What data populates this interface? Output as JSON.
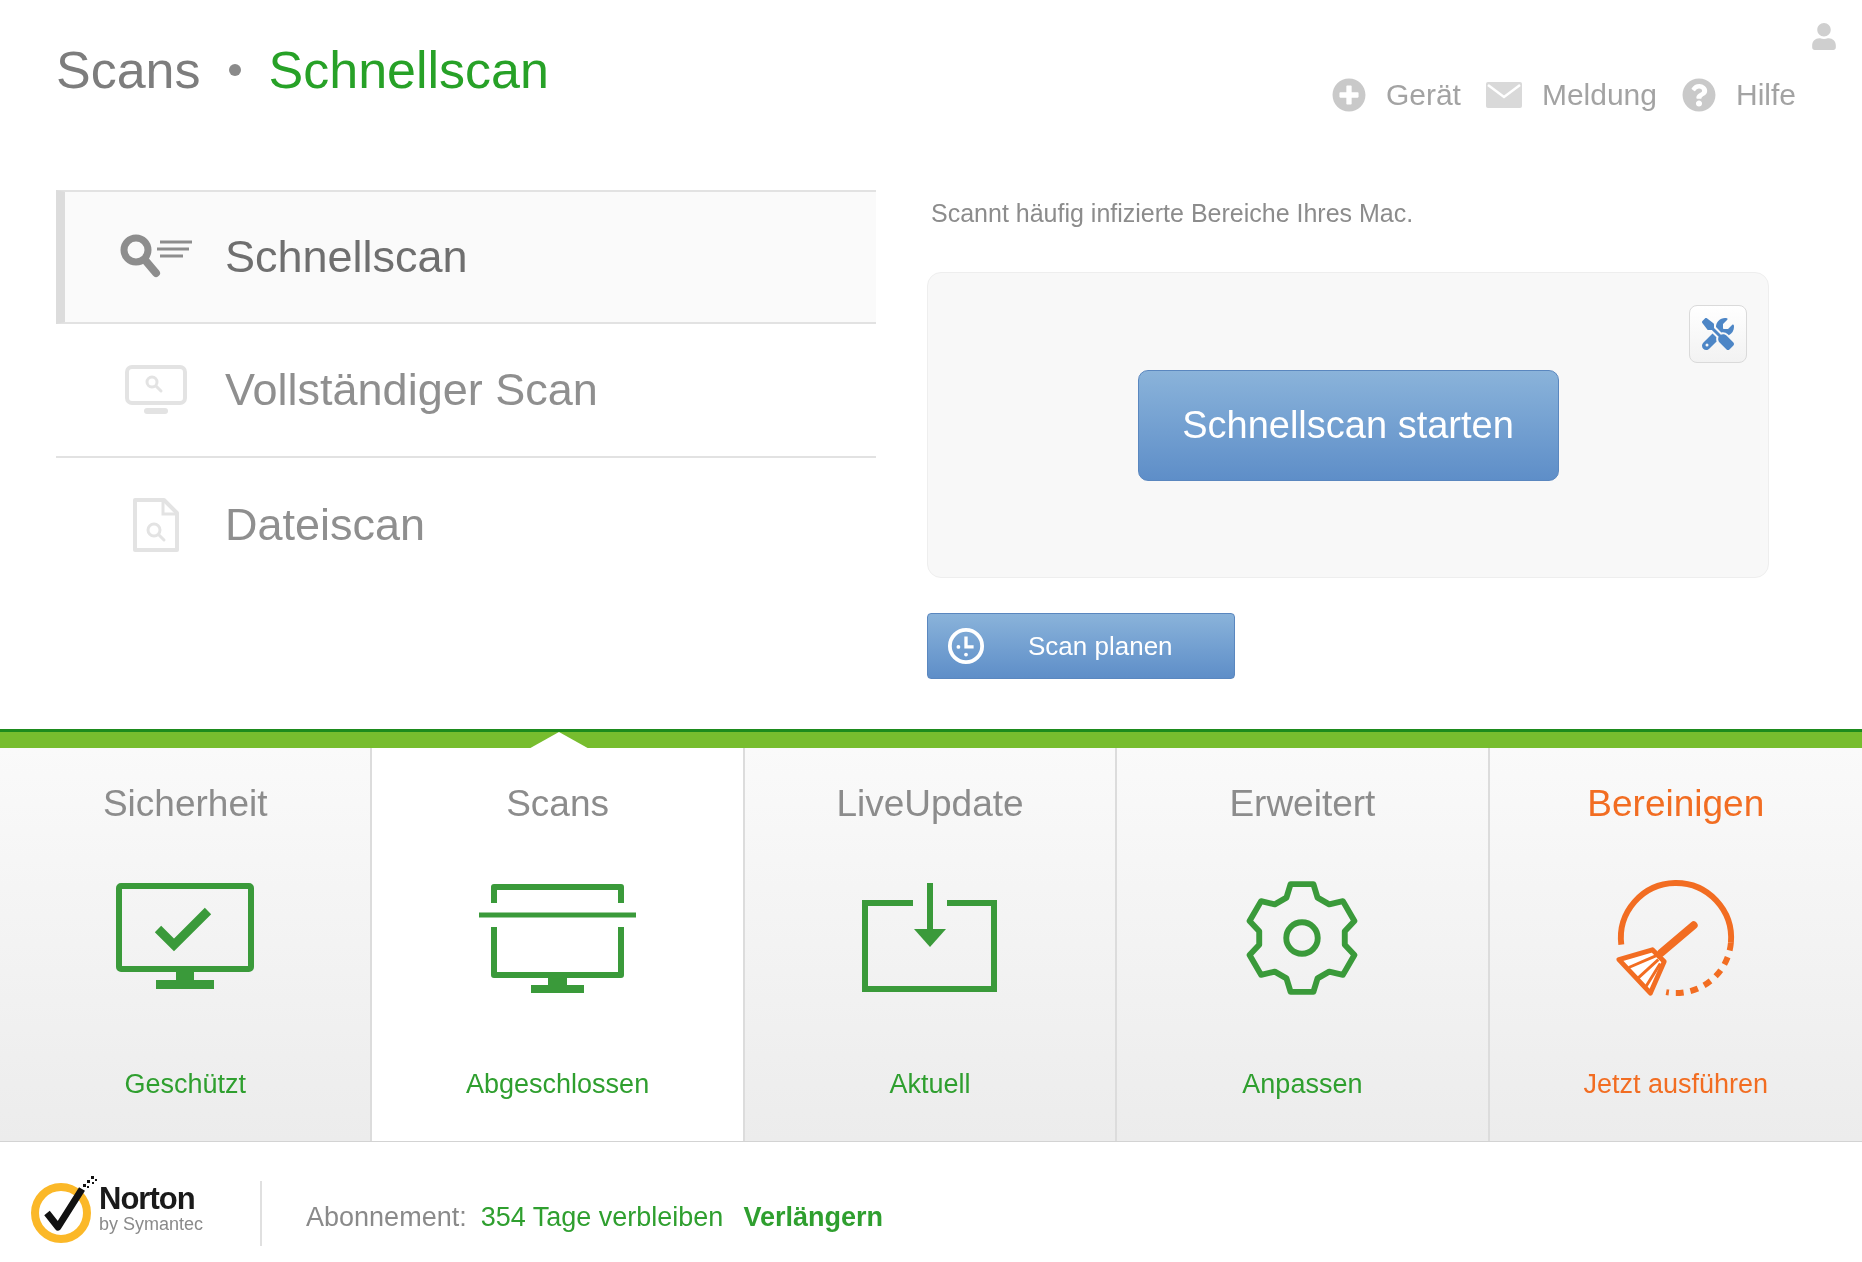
{
  "header": {
    "breadcrumb": [
      {
        "label": "Scans",
        "current": false
      },
      {
        "label": "Schnellscan",
        "current": true
      }
    ],
    "toolbar": [
      {
        "kind": "add",
        "label": "Gerät"
      },
      {
        "kind": "mail",
        "label": "Meldung"
      },
      {
        "kind": "help",
        "label": "Hilfe"
      }
    ]
  },
  "scan_types": [
    {
      "kind": "quick",
      "label": "Schnellscan",
      "selected": true
    },
    {
      "kind": "full",
      "label": "Vollständiger Scan",
      "selected": false
    },
    {
      "kind": "file",
      "label": "Dateiscan",
      "selected": false
    }
  ],
  "scan_panel": {
    "description": "Scannt häufig infizierte Bereiche Ihres Mac.",
    "start_button": "Schnellscan starten",
    "schedule_button": "Scan planen"
  },
  "nav_tiles": [
    {
      "kind": "security",
      "title": "Sicherheit",
      "status": "Geschützt",
      "selected": false,
      "alert": false
    },
    {
      "kind": "scans",
      "title": "Scans",
      "status": "Abgeschlossen",
      "selected": true,
      "alert": false
    },
    {
      "kind": "update",
      "title": "LiveUpdate",
      "status": "Aktuell",
      "selected": false,
      "alert": false
    },
    {
      "kind": "advanced",
      "title": "Erweitert",
      "status": "Anpassen",
      "selected": false,
      "alert": false
    },
    {
      "kind": "cleanup",
      "title": "Bereinigen",
      "status": "Jetzt ausführen",
      "selected": false,
      "alert": true
    }
  ],
  "footer": {
    "brand": {
      "name": "Norton",
      "tagline": "by Symantec"
    },
    "subscription": {
      "label": "Abonnement:",
      "value": "354 Tage verbleiben",
      "action": "Verlängern"
    }
  }
}
